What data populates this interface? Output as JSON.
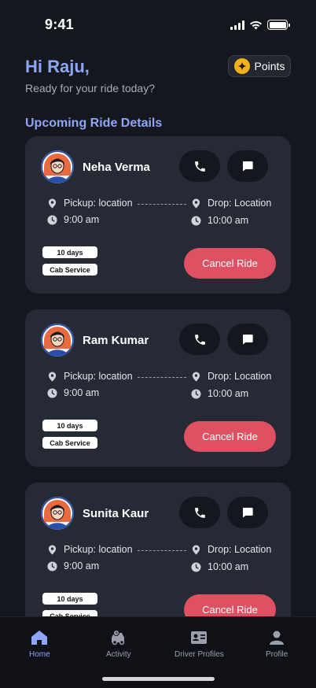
{
  "status_bar": {
    "time": "9:41"
  },
  "header": {
    "greeting": "Hi Raju,",
    "subtitle": "Ready for your ride today?",
    "points_label": "Points"
  },
  "section_title": "Upcoming Ride Details",
  "rides": [
    {
      "name": "Neha Verma",
      "pickup": "Pickup: location",
      "drop": "Drop: Location",
      "pickup_time": "9:00 am",
      "drop_time": "10:00 am",
      "duration": "10 days",
      "service": "Cab Service",
      "cancel_label": "Cancel Ride"
    },
    {
      "name": "Ram Kumar",
      "pickup": "Pickup: location",
      "drop": "Drop: Location",
      "pickup_time": "9:00 am",
      "drop_time": "10:00 am",
      "duration": "10 days",
      "service": "Cab Service",
      "cancel_label": "Cancel Ride"
    },
    {
      "name": "Sunita Kaur",
      "pickup": "Pickup: location",
      "drop": "Drop: Location",
      "pickup_time": "9:00 am",
      "drop_time": "10:00 am",
      "duration": "10 days",
      "service": "Cab Service",
      "cancel_label": "Cancel Ride"
    }
  ],
  "bottom_nav": [
    {
      "label": "Home",
      "icon": "home-icon",
      "active": true
    },
    {
      "label": "Activity",
      "icon": "activity-icon",
      "active": false
    },
    {
      "label": "Driver Profiles",
      "icon": "driver-profiles-icon",
      "active": false
    },
    {
      "label": "Profile",
      "icon": "profile-icon",
      "active": false
    }
  ],
  "colors": {
    "background": "#15171e",
    "card": "#262a35",
    "accent": "#8ea6f5",
    "cancel": "#dd5162",
    "points": "#f5b11c"
  }
}
